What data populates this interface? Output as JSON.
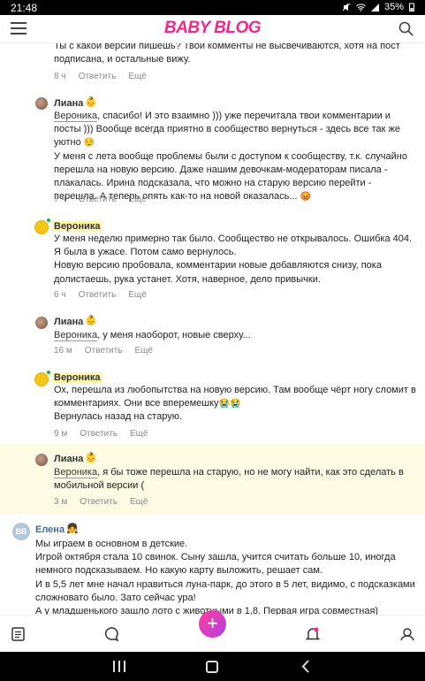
{
  "status_bar": {
    "time": "21:48",
    "battery": "35%",
    "icons": [
      "mute-icon",
      "wifi-icon",
      "signal-icon",
      "battery-icon"
    ]
  },
  "app": {
    "logo": "BABY BLOG",
    "brand_color": "#ee2b8b"
  },
  "comments": [
    {
      "author": "",
      "text": [
        "Ты с какой версии пишешь? Твои комменты не высвечиваются, хотя на пост подписана, и остальные вижу."
      ],
      "time": "8 ч",
      "reply": "Ответить",
      "more": "Ещё"
    },
    {
      "author": "Лиана",
      "mention": "Вероника",
      "text": [
        ", спасибо! И это взаимно ))) уже перечитала твои комментарии и посты ))) Вообще всегда приятно в сообщество вернуться - здесь все так же уютно",
        "У меня с лета вообще проблемы были с доступом к сообществу, т.к. случайно перешла на новую версию. Даже нашим девочкам-модераторам писала - плакалась. Ирина подсказала, что можно на старую версию перейти - перешла. А теперь опять как-то на новой оказалась..."
      ],
      "time": "7 ч",
      "reply": "Ответить",
      "more": "Ещё"
    },
    {
      "author": "Вероника",
      "text": [
        "У меня неделю примерно так было. Сообщество не открывалось. Ошибка 404. Я была в ужасе. Потом само вернулось.",
        "Новую версию пробовала, комментарии новые добавляются снизу, пока долистаешь, рука устанет. Хотя, наверное, дело привычки."
      ],
      "time": "6 ч",
      "reply": "Ответить",
      "more": "Ещё"
    },
    {
      "author": "Лиана",
      "mention": "Вероника",
      "text": [
        ", у меня наоборот, новые сверху..."
      ],
      "time": "16 м",
      "reply": "Ответить",
      "more": "Ещё"
    },
    {
      "author": "Вероника",
      "text": [
        "Ох, перешла из любопытства на новую версию. Там вообще чёрт ногу сломит в комментариях. Они все вперемешку",
        "Вернулась назад на старую."
      ],
      "time": "9 м",
      "reply": "Ответить",
      "more": "Ещё"
    },
    {
      "author": "Лиана",
      "mention": "Вероника",
      "text": [
        ", я бы тоже перешла на старую, но не могу найти, как это сделать в мобильной версии ("
      ],
      "time": "3 м",
      "reply": "Ответить",
      "more": "Ещё"
    },
    {
      "author": "Елена",
      "avatar_text": "BB",
      "text": [
        "Мы играем в основном в детские.",
        "Игрой октября стала 10 свинок. Сыну зашла, учится считать больше 10, иногда немного подсказываем. Но какую карту выложить, решает сам.",
        "И в 5,5 лет мне начал нравиться луна-парк, до этого в 5 лет, видимо, с подсказками сложновато было. Зато сейчас ура!",
        "А у младшенького зашло лото с животными в 1,8. Первая игра совместная)"
      ]
    }
  ],
  "bottom_nav": {
    "fab_label": "+",
    "icons": [
      "feed-icon",
      "chat-icon",
      "add-icon",
      "notifications-icon",
      "profile-icon"
    ]
  }
}
